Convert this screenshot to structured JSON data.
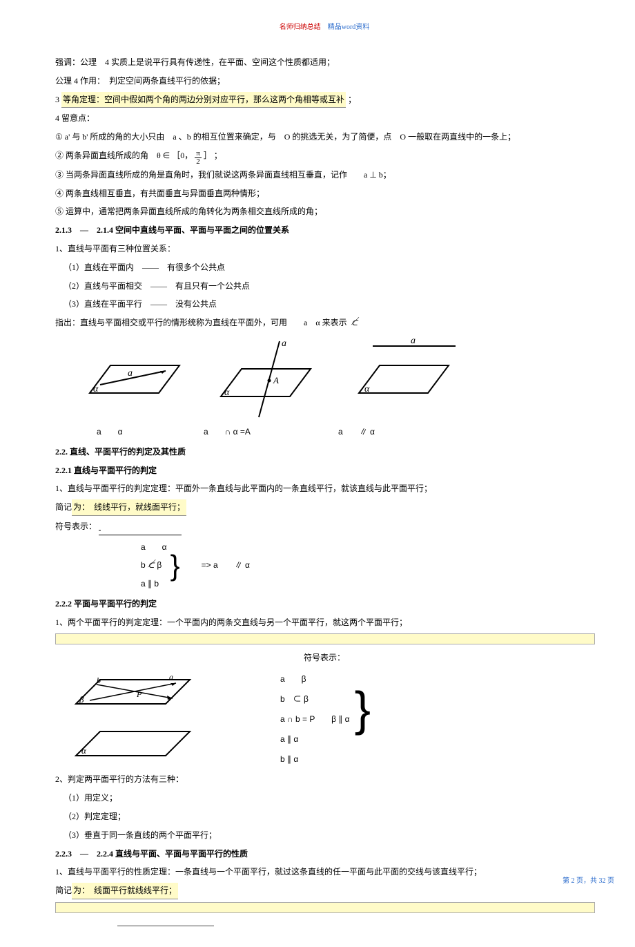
{
  "header": {
    "red": "名师归纳总结",
    "blue": "精品word资料"
  },
  "para": {
    "p1": "强调：公理　4 实质上是说平行具有传递性，在平面、空间这个性质都适用；",
    "p2": "公理 4 作用：　判定空间两条直线平行的依据；",
    "p3a": "3",
    "p3b": "等角定理：空间中假如两个角的两边分别对应平行，那么这两个角相等或互补",
    "p3c": "；",
    "p4": "4 留意点：",
    "p5a": "① a' 与 b' 所成的角的大小只由　a 、b 的相互位置来确定，与　O 的挑选无关，为了简便，点　O 一般取在两直线中的一条上；",
    "p6a": "② 两条异面直线所成的角　θ ∈ ［0，",
    "p6b": "］ ；",
    "p7": "③ 当两条异面直线所成的角是直角时，我们就说这两条异面直线相互垂直，记作　　a ⊥ b；",
    "p8": "④ 两条直线相互垂直，有共面垂直与异面垂直两种情形；",
    "p9": "⑤ 运算中，通常把两条异面直线所成的角转化为两条相交直线所成的角；",
    "h213": "2.1.3　—　2.1.4 空间中直线与平面、平面与平面之间的位置关系",
    "p10": "1、直线与平面有三种位置关系：",
    "p11": "（1）直线在平面内　——　有很多个公共点",
    "p12": "（2）直线与平面相交　——　有且只有一个公共点",
    "p13": "（3）直线在平面平行　——　没有公共点",
    "p14a": "指出：直线与平面相交或平行的情形统称为直线在平面外，可用　　a　α 来表示",
    "lbl1": "a　　α",
    "lbl2": "a　　∩ α =A",
    "lbl3": "a　　∥ α",
    "h22": "2.2. 直线、平面平行的判定及其性质",
    "h221": "2.2.1 直线与平面平行的判定",
    "p15": "1、直线与平面平行的判定定理：平面外一条直线与此平面内的一条直线平行，就该直线与此平面平行；",
    "p16a": "简记",
    "p16b": "为：　线线平行，就线面平行；",
    "p17": "符号表示：",
    "sym1a": "a　　α",
    "sym1b_a": "b ",
    "sym1b_b": " β",
    "sym1b_end": "　　=> a　　∥ α",
    "sym1c": "a ∥ b",
    "h222": "2.2.2 平面与平面平行的判定",
    "p18": "1、两个平面平行的判定定理：一个平面内的两条交直线与另一个平面平行，就这两个平面平行；",
    "p19": "符号表示：",
    "sym2a": "a　　β",
    "sym2b": "b　⊂ β",
    "sym2c": "a ∩ b = P　　β ∥ α",
    "sym2d": "a ∥ α",
    "sym2e": "b ∥ α",
    "p20": "2、判定两平面平行的方法有三种：",
    "p21": "（1）用定义；",
    "p22": "（2）判定定理；",
    "p23": "（3）垂直于同一条直线的两个平面平行；",
    "h223": "2.2.3　—　2.2.4 直线与平面、平面与平面平行的性质",
    "p24": "1、直线与平面平行的性质定理：一条直线与一个平面平行，就过这条直线的任一平面与此平面的交线与该直线平行；",
    "p25a": "简记",
    "p25b": "为：　线面平行就线线平行；"
  },
  "footer": "第 2 页，共 32 页"
}
